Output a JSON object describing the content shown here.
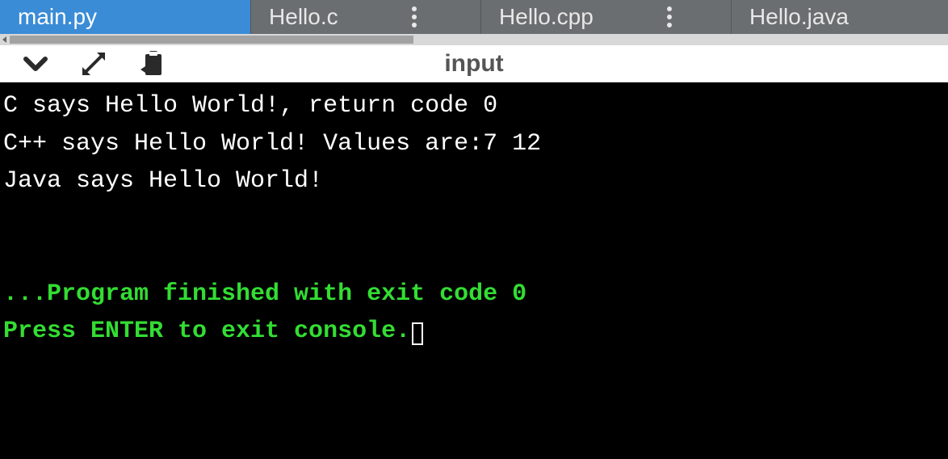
{
  "tabs": [
    {
      "label": "main.py",
      "active": true,
      "has_more": false
    },
    {
      "label": "Hello.c",
      "active": false,
      "has_more": true
    },
    {
      "label": "Hello.cpp",
      "active": false,
      "has_more": true
    },
    {
      "label": "Hello.java",
      "active": false,
      "has_more": false
    }
  ],
  "toolbar": {
    "title": "input"
  },
  "console": {
    "lines": [
      "C says Hello World!, return code 0",
      "C++ says Hello World! Values are:7 12",
      "Java says Hello World!",
      "",
      ""
    ],
    "green_lines": [
      "...Program finished with exit code 0",
      "Press ENTER to exit console."
    ]
  }
}
